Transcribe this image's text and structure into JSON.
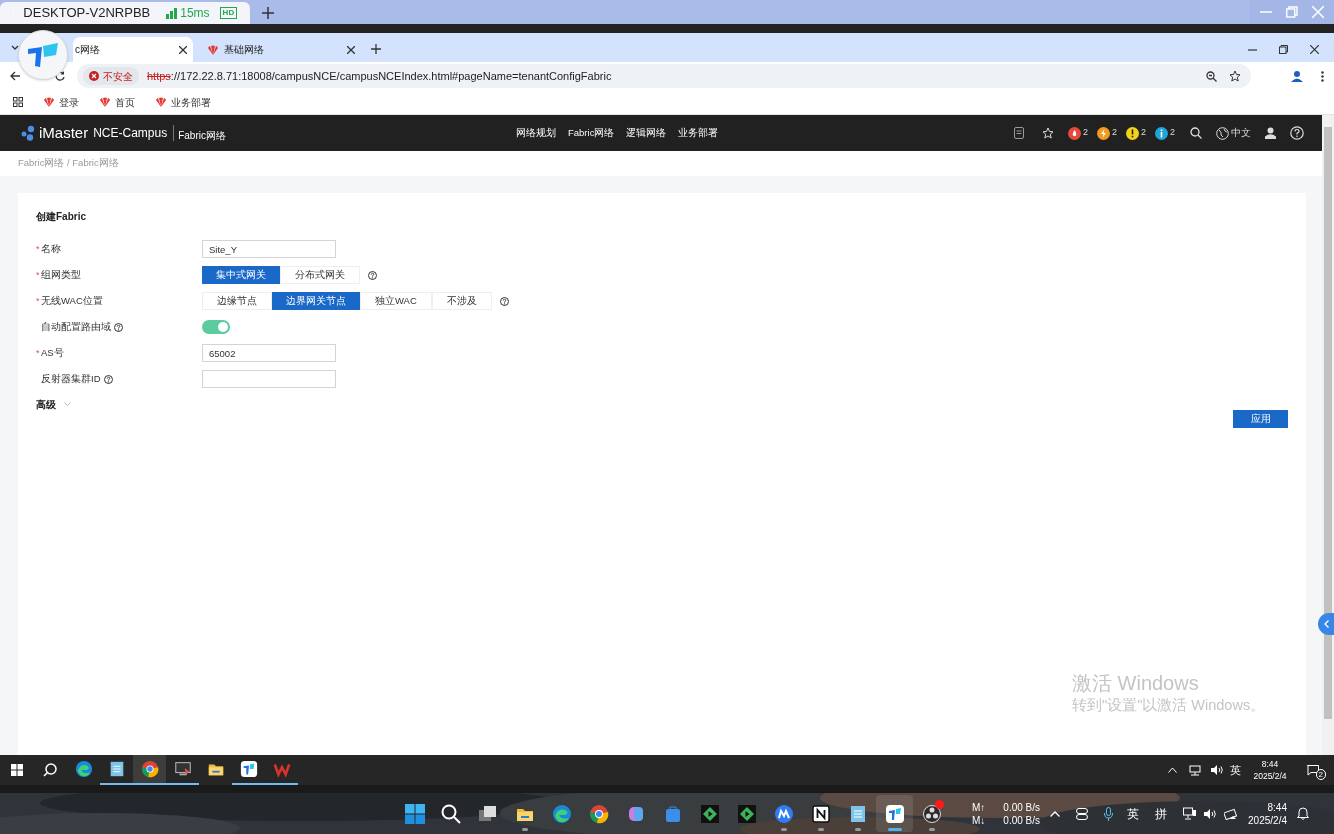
{
  "remote_tab": {
    "title": "DESKTOP-V2NRPBB",
    "latency": "15ms",
    "quality": "HD"
  },
  "browser": {
    "tabs": [
      {
        "title": "c网络",
        "selected": true
      },
      {
        "title": "基础网络",
        "selected": false
      }
    ],
    "security": "不安全",
    "url_scheme": "https",
    "url_rest": "://172.22.8.71:18008/campusNCE/campusNCEIndex.html#pageName=tenantConfigFabric",
    "bookmarks": [
      "登录",
      "首页",
      "业务部署"
    ]
  },
  "app": {
    "brand": "iMaster",
    "product": "NCE-Campus",
    "context": "Fabric网络",
    "nav": [
      "网络规划",
      "Fabric网络",
      "逻辑网络",
      "业务部署"
    ],
    "alarms": [
      {
        "kind": "critical",
        "count": "2",
        "color": "#e8473b"
      },
      {
        "kind": "major",
        "count": "2",
        "color": "#f39a1e"
      },
      {
        "kind": "minor",
        "count": "2",
        "color": "#f2d21b"
      },
      {
        "kind": "info",
        "count": "2",
        "color": "#1fa6d9"
      }
    ],
    "language": "中文"
  },
  "breadcrumb": "Fabric网络 / Fabric网络",
  "form": {
    "title": "创建Fabric",
    "fields": [
      {
        "kind": "input",
        "marker": "*",
        "label": "名称",
        "help": false,
        "value": "Site_Y"
      },
      {
        "kind": "segmented",
        "marker": "*",
        "label": "组网类型",
        "help": true,
        "options": [
          {
            "label": "集中式网关",
            "selected": true
          },
          {
            "label": "分布式网关",
            "selected": false
          }
        ]
      },
      {
        "kind": "segmented",
        "marker": "*",
        "label": "无线WAC位置",
        "help": true,
        "options": [
          {
            "label": "边缘节点",
            "selected": false
          },
          {
            "label": "边界网关节点",
            "selected": true
          },
          {
            "label": "独立WAC",
            "selected": false
          },
          {
            "label": "不涉及",
            "selected": false
          }
        ]
      },
      {
        "kind": "switch",
        "label": "自动配置路由域",
        "help": true,
        "on": true
      },
      {
        "kind": "input",
        "marker": "*",
        "label": "AS号",
        "help": false,
        "value": "65002"
      },
      {
        "kind": "input",
        "label": "反射器集群ID",
        "help": true
      }
    ],
    "advanced": "高级",
    "apply": "应用"
  },
  "activation": {
    "title": "激活 Windows",
    "hint": "转到\"设置\"以激活 Windows。"
  },
  "inner_taskbar": {
    "apps": [
      {
        "kind": "edge",
        "running": false
      },
      {
        "kind": "notepad",
        "running": true
      },
      {
        "kind": "chrome",
        "running": true
      },
      {
        "kind": "remote",
        "running": true
      },
      {
        "kind": "folder",
        "running": false
      },
      {
        "kind": "todesk",
        "running": true
      },
      {
        "kind": "wps",
        "running": true
      }
    ],
    "ime": "英",
    "time": "8:44",
    "date": "2025/2/4",
    "notifications": "2"
  },
  "outer_taskbar": {
    "apps": [
      {
        "kind": "folder",
        "running": true,
        "active": false
      },
      {
        "kind": "edge",
        "running": false,
        "active": false
      },
      {
        "kind": "chrome",
        "running": false,
        "active": false
      },
      {
        "kind": "copilot",
        "running": false,
        "active": false
      },
      {
        "kind": "store",
        "running": false,
        "active": false
      },
      {
        "kind": "player",
        "running": false,
        "active": false
      },
      {
        "kind": "player",
        "running": false,
        "active": false
      },
      {
        "kind": "mblue",
        "running": true,
        "active": false
      },
      {
        "kind": "notion",
        "running": true,
        "active": false
      },
      {
        "kind": "notepad",
        "running": true,
        "active": false
      },
      {
        "kind": "todesk",
        "running": true,
        "active": true
      },
      {
        "kind": "obs",
        "running": true,
        "active": false
      }
    ],
    "upload_label": "M↑",
    "upload": "0.00 B/s",
    "download_label": "M↓",
    "download": "0.00 B/s",
    "ime": [
      "英",
      "拼"
    ],
    "time": "8:44",
    "date": "2025/2/4"
  }
}
